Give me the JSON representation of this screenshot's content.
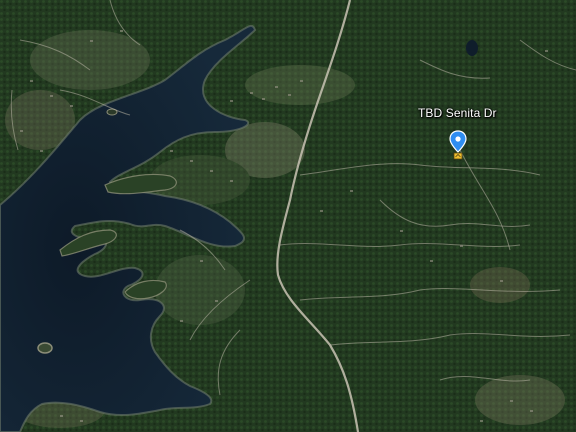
{
  "map": {
    "view": "satellite",
    "marker": {
      "label": "TBD Senita Dr",
      "icon": "location-pin-icon",
      "color": "#2f8df0"
    },
    "colors": {
      "water": "#0f1d2b",
      "forest": "#233a22",
      "clearing": "#5b6a4a",
      "road": "#c9c3b4"
    }
  }
}
